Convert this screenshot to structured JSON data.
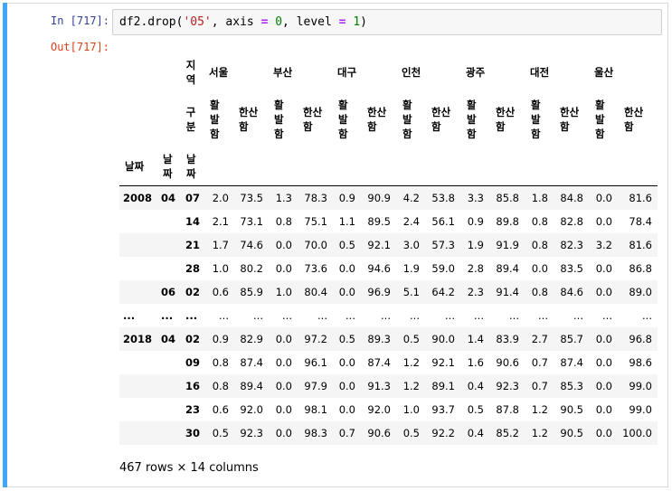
{
  "input": {
    "prompt": "In [717]:",
    "code_parts": [
      "df2.drop(",
      "'05'",
      ", axis ",
      "=",
      " ",
      "0",
      ", level ",
      "=",
      " ",
      "1",
      ")"
    ]
  },
  "output": {
    "prompt": "Out[717]:",
    "columns_level0_name": "지역",
    "columns_level1_name": "구분",
    "regions": [
      "서울",
      "부산",
      "대구",
      "인천",
      "광주",
      "대전",
      "울산"
    ],
    "sub_cols": [
      "활발함",
      "한산함"
    ],
    "index_names": [
      "날짜",
      "날짜",
      "날짜"
    ],
    "rows": [
      {
        "l0": "2008",
        "l1": "04",
        "l2": "07",
        "vals": [
          "2.0",
          "73.5",
          "1.3",
          "78.3",
          "0.9",
          "90.9",
          "4.2",
          "53.8",
          "3.3",
          "85.8",
          "1.8",
          "84.8",
          "0.0",
          "81.6"
        ]
      },
      {
        "l0": "",
        "l1": "",
        "l2": "14",
        "vals": [
          "2.1",
          "73.1",
          "0.8",
          "75.1",
          "1.1",
          "89.5",
          "2.4",
          "56.1",
          "0.9",
          "89.8",
          "0.8",
          "82.8",
          "0.0",
          "78.4"
        ]
      },
      {
        "l0": "",
        "l1": "",
        "l2": "21",
        "vals": [
          "1.7",
          "74.6",
          "0.0",
          "70.0",
          "0.5",
          "92.1",
          "3.0",
          "57.3",
          "1.9",
          "91.9",
          "0.8",
          "82.3",
          "3.2",
          "81.6"
        ]
      },
      {
        "l0": "",
        "l1": "",
        "l2": "28",
        "vals": [
          "1.0",
          "80.2",
          "0.0",
          "73.6",
          "0.0",
          "94.6",
          "1.9",
          "59.0",
          "2.8",
          "89.4",
          "0.0",
          "83.5",
          "0.0",
          "86.8"
        ]
      },
      {
        "l0": "",
        "l1": "06",
        "l2": "02",
        "vals": [
          "0.6",
          "85.9",
          "1.0",
          "80.4",
          "0.0",
          "96.9",
          "5.1",
          "64.2",
          "2.3",
          "91.4",
          "0.8",
          "84.6",
          "0.0",
          "89.0"
        ]
      },
      {
        "l0": "...",
        "l1": "...",
        "l2": "...",
        "vals": [
          "...",
          "...",
          "...",
          "...",
          "...",
          "...",
          "...",
          "...",
          "...",
          "...",
          "...",
          "...",
          "...",
          "..."
        ]
      },
      {
        "l0": "2018",
        "l1": "04",
        "l2": "02",
        "vals": [
          "0.9",
          "82.9",
          "0.0",
          "97.2",
          "0.5",
          "89.3",
          "0.5",
          "90.0",
          "1.4",
          "83.9",
          "2.7",
          "85.7",
          "0.0",
          "96.8"
        ]
      },
      {
        "l0": "",
        "l1": "",
        "l2": "09",
        "vals": [
          "0.8",
          "87.4",
          "0.0",
          "96.1",
          "0.0",
          "87.4",
          "1.2",
          "92.1",
          "1.6",
          "90.6",
          "0.7",
          "87.4",
          "0.0",
          "98.6"
        ]
      },
      {
        "l0": "",
        "l1": "",
        "l2": "16",
        "vals": [
          "0.8",
          "89.4",
          "0.0",
          "97.9",
          "0.0",
          "91.3",
          "1.2",
          "89.1",
          "0.4",
          "92.3",
          "0.7",
          "85.3",
          "0.0",
          "99.0"
        ]
      },
      {
        "l0": "",
        "l1": "",
        "l2": "23",
        "vals": [
          "0.6",
          "92.0",
          "0.0",
          "98.1",
          "0.0",
          "92.0",
          "1.0",
          "93.7",
          "0.5",
          "87.8",
          "1.2",
          "90.5",
          "0.0",
          "99.0"
        ]
      },
      {
        "l0": "",
        "l1": "",
        "l2": "30",
        "vals": [
          "0.5",
          "92.3",
          "0.0",
          "98.3",
          "0.7",
          "90.6",
          "0.5",
          "92.2",
          "0.4",
          "85.2",
          "1.2",
          "90.5",
          "0.0",
          "100.0"
        ]
      }
    ],
    "footer": "467 rows × 14 columns"
  },
  "colors": {
    "cell_bar": "#42a5f5",
    "in_prompt": "#303f9f",
    "out_prompt": "#d84315",
    "stripe": "#f5f5f5"
  }
}
